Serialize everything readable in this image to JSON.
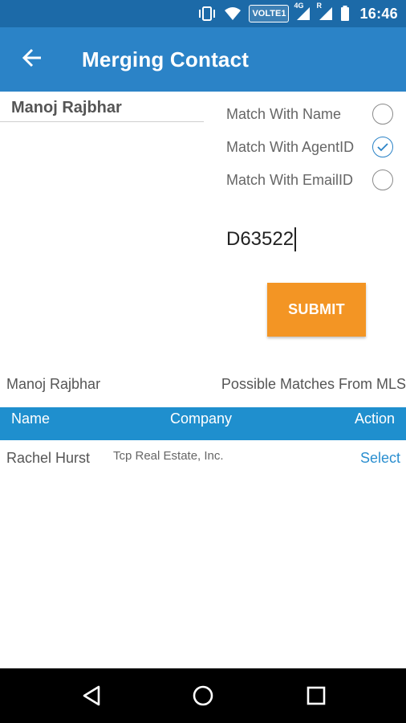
{
  "status_bar": {
    "network_badge": "VOLTE1",
    "signal1_label": "4G",
    "signal2_label": "R",
    "time": "16:46",
    "icons": [
      "vibrate-icon",
      "wifi-icon",
      "signal-4g-icon",
      "signal-roaming-icon",
      "battery-icon"
    ]
  },
  "app_bar": {
    "title": "Merging Contact",
    "back_icon": "arrow-left-icon"
  },
  "form": {
    "contact_name": "Manoj Rajbhar",
    "options": [
      {
        "label": "Match With Name",
        "checked": false
      },
      {
        "label": "Match With AgentID",
        "checked": true
      },
      {
        "label": "Match With EmailID",
        "checked": false
      }
    ],
    "agent_id_value": "D63522",
    "submit_label": "SUBMIT"
  },
  "results": {
    "contact_name": "Manoj Rajbhar",
    "heading": "Possible Matches From MLS",
    "columns": [
      "Name",
      "Company",
      "Action"
    ],
    "rows": [
      {
        "name": "Rachel Hurst",
        "company": "Tcp Real Estate, Inc.",
        "action": "Select"
      }
    ]
  },
  "nav_bar": {
    "icons": [
      "back-triangle-icon",
      "home-circle-icon",
      "recents-square-icon"
    ]
  },
  "colors": {
    "status_bar": "#1c6aa8",
    "app_bar": "#2b83c7",
    "table_header": "#1f8fce",
    "submit": "#f39524",
    "link": "#2b8fd0"
  }
}
